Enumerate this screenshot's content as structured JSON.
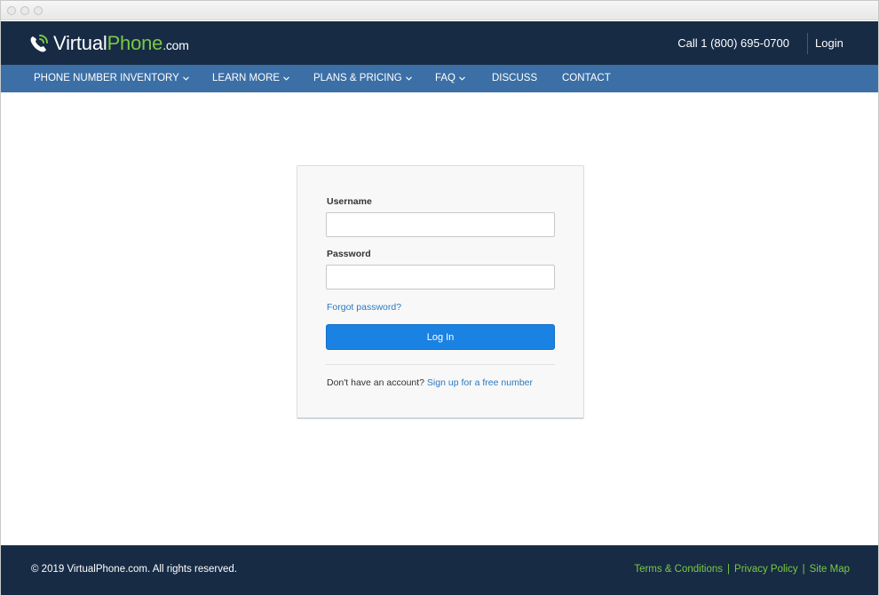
{
  "brand": {
    "name_part1": "Virtual",
    "name_part2": "Phone",
    "name_part3": ".com",
    "accent_color": "#7ac943",
    "icon": "phone-handset-icon"
  },
  "header": {
    "call_text": "Call 1 (800) 695-0700",
    "login_label": "Login"
  },
  "nav": {
    "items": [
      {
        "label": "PHONE NUMBER INVENTORY",
        "has_dropdown": true
      },
      {
        "label": "LEARN MORE",
        "has_dropdown": true
      },
      {
        "label": "PLANS & PRICING",
        "has_dropdown": true
      },
      {
        "label": "FAQ",
        "has_dropdown": true
      },
      {
        "label": "DISCUSS",
        "has_dropdown": false
      },
      {
        "label": "CONTACT",
        "has_dropdown": false
      }
    ]
  },
  "login_form": {
    "username_label": "Username",
    "username_value": "",
    "password_label": "Password",
    "password_value": "",
    "forgot_password": "Forgot password?",
    "submit_label": "Log In",
    "signup_prompt": "Don't have an account?",
    "signup_link": "Sign up for a free number",
    "button_color": "#1a82e2"
  },
  "footer": {
    "copyright": "© 2019 VirtualPhone.com. All rights reserved.",
    "links": [
      {
        "label": "Terms & Conditions"
      },
      {
        "label": "Privacy Policy"
      },
      {
        "label": "Site Map"
      }
    ],
    "separator": "|"
  },
  "colors": {
    "header_bg": "#172b45",
    "nav_bg": "#3b6fa6",
    "link": "#2a7ac0"
  }
}
